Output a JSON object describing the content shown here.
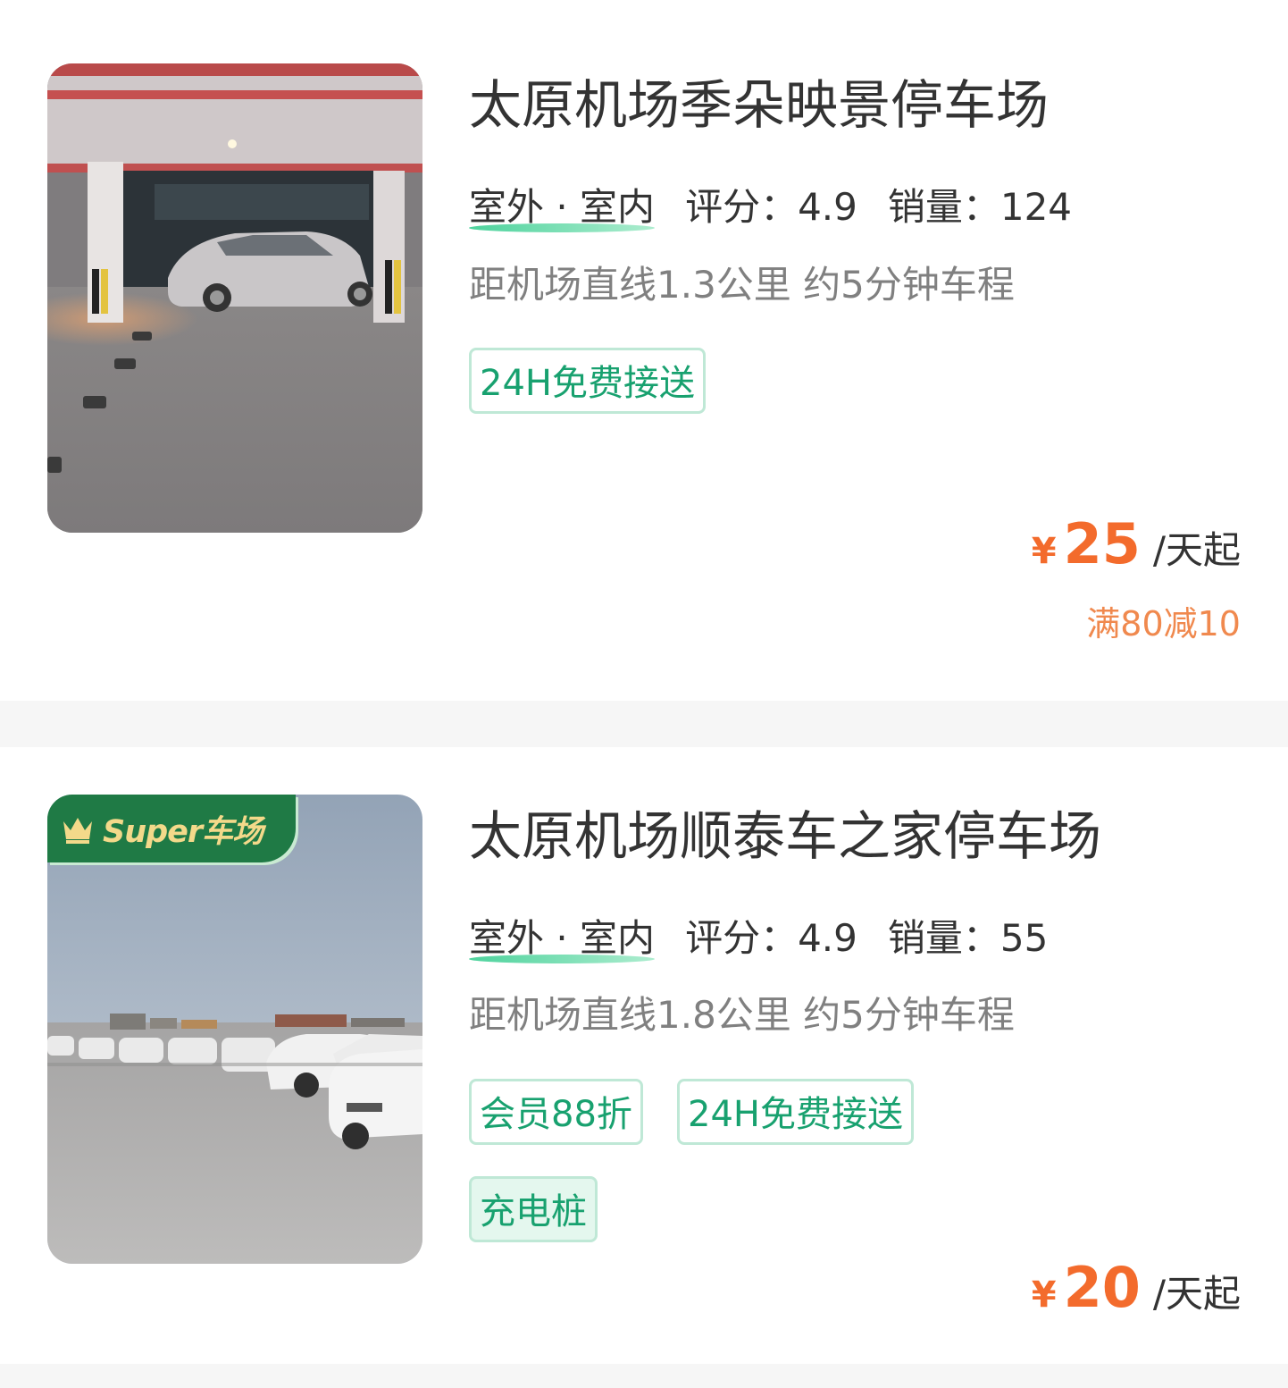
{
  "listings": [
    {
      "name": "太原机场季朵映景停车场",
      "type": "室外 · 室内",
      "rating_label": "评分：4.9",
      "sales_label": "销量：124",
      "distance": "距机场直线1.3公里 约5分钟车程",
      "tags": [
        "24H免费接送"
      ],
      "price_symbol": "¥",
      "price": "25",
      "price_unit": "/天起",
      "coupon": "满80减10",
      "image": "indoor-parking-garage-photo"
    },
    {
      "name": "太原机场顺泰车之家停车场",
      "type": "室外 · 室内",
      "rating_label": "评分：4.9",
      "sales_label": "销量：55",
      "distance": "距机场直线1.8公里 约5分钟车程",
      "tags": [
        "会员88折",
        "24H免费接送",
        "充电桩"
      ],
      "badge": "Super车场",
      "price_symbol": "¥",
      "price": "20",
      "price_unit": "/天起",
      "image": "outdoor-parking-lot-photo"
    }
  ],
  "colors": {
    "accent_green": "#18a16f",
    "price_orange": "#f36b2c",
    "coupon_orange": "#f0894e",
    "badge_green": "#1f7a45"
  }
}
